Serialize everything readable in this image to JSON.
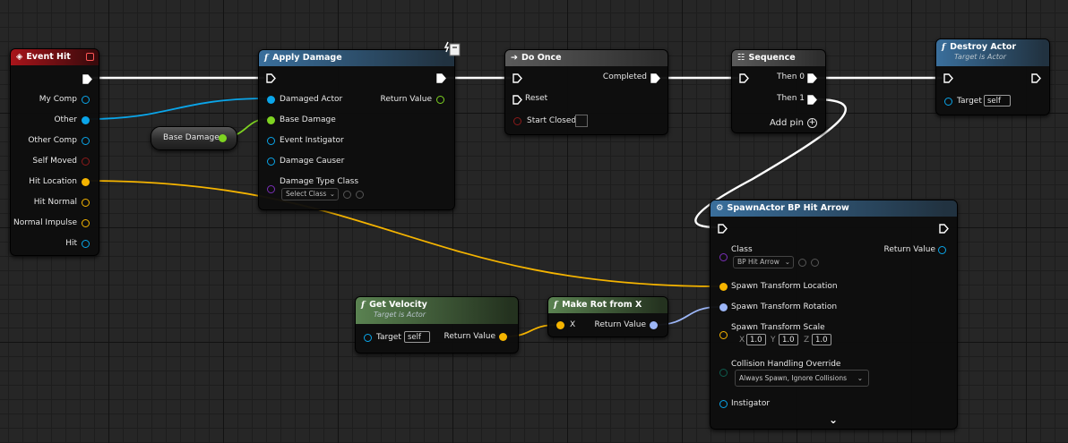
{
  "colors": {
    "exec": "#ffffff",
    "object": "#0aa5e9",
    "float": "#7ed321",
    "struct": "#f5b400",
    "rotator": "#9cb6f7",
    "class": "#7a2fb8",
    "bool": "#8b1a1a",
    "byte": "#0e5c4e"
  },
  "nodes": {
    "event_hit": {
      "title": "Event Hit",
      "pins": [
        "My Comp",
        "Other",
        "Other Comp",
        "Self Moved",
        "Hit Location",
        "Hit Normal",
        "Normal Impulse",
        "Hit"
      ]
    },
    "base_damage": {
      "label": "Base Damage"
    },
    "apply_damage": {
      "title": "Apply Damage",
      "inputs": [
        "Damaged Actor",
        "Base Damage",
        "Event Instigator",
        "Damage Causer",
        "Damage Type Class"
      ],
      "output": "Return Value",
      "class_dropdown": "Select Class"
    },
    "do_once": {
      "title": "Do Once",
      "completed": "Completed",
      "reset": "Reset",
      "start_closed": "Start Closed"
    },
    "sequence": {
      "title": "Sequence",
      "then0": "Then 0",
      "then1": "Then 1",
      "add_pin": "Add pin"
    },
    "destroy_actor": {
      "title": "Destroy Actor",
      "subtitle": "Target is Actor",
      "target_label": "Target",
      "target_value": "self"
    },
    "get_velocity": {
      "title": "Get Velocity",
      "subtitle": "Target is Actor",
      "target_label": "Target",
      "target_value": "self",
      "return_label": "Return Value"
    },
    "make_rot": {
      "title": "Make Rot from X",
      "x_label": "X",
      "return_label": "Return Value"
    },
    "spawn_actor": {
      "title": "SpawnActor BP Hit Arrow",
      "class_label": "Class",
      "class_value": "BP Hit Arrow",
      "return_label": "Return Value",
      "location": "Spawn Transform Location",
      "rotation": "Spawn Transform Rotation",
      "scale": "Spawn Transform Scale",
      "scale_x_label": "X",
      "scale_x": "1.0",
      "scale_y_label": "Y",
      "scale_y": "1.0",
      "scale_z_label": "Z",
      "scale_z": "1.0",
      "collision_label": "Collision Handling Override",
      "collision_value": "Always Spawn, Ignore Collisions",
      "instigator": "Instigator"
    }
  }
}
